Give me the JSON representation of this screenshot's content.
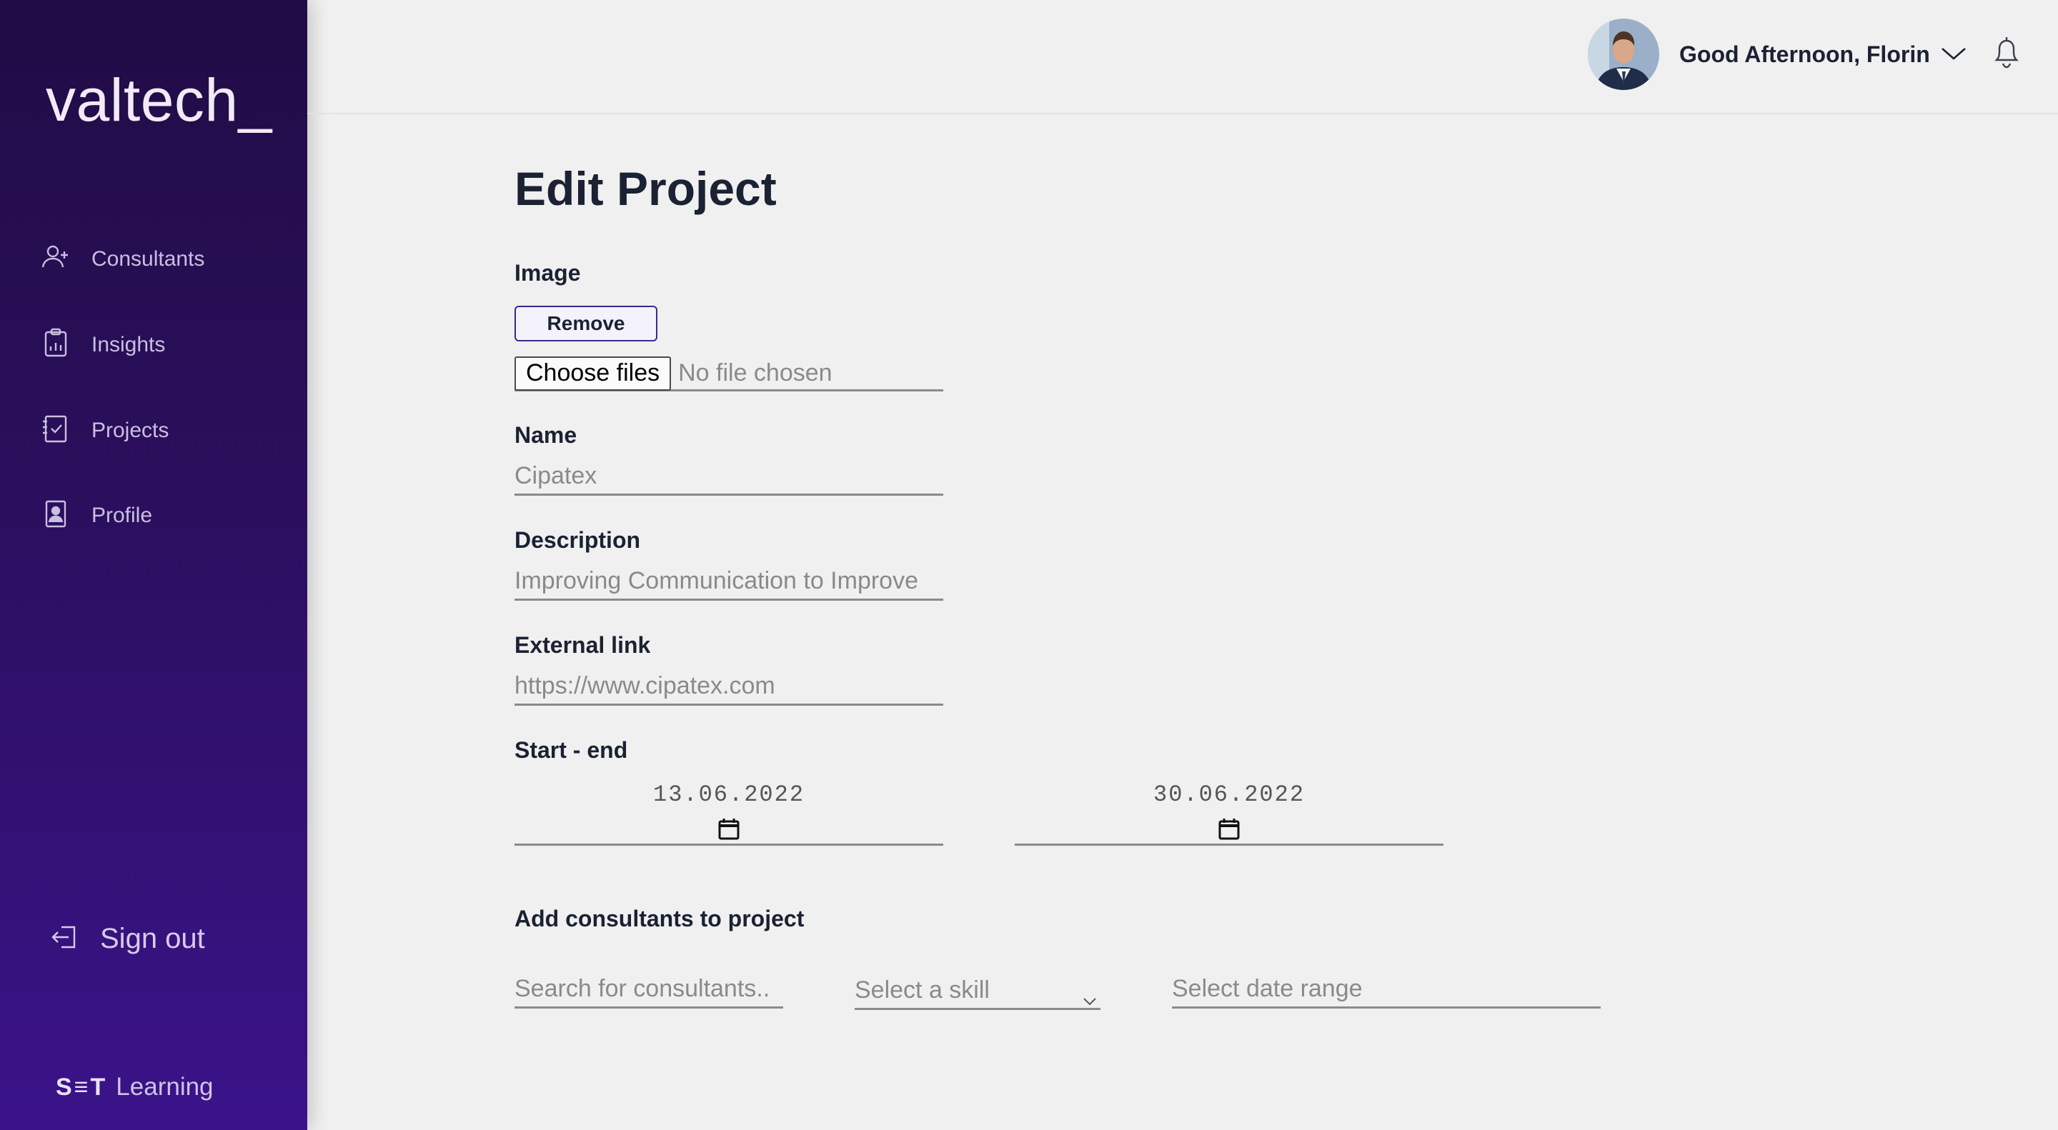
{
  "sidebar": {
    "logo": "valtech_",
    "items": [
      {
        "label": "Consultants",
        "icon": "user-plus-icon"
      },
      {
        "label": "Insights",
        "icon": "clipboard-chart-icon"
      },
      {
        "label": "Projects",
        "icon": "clipboard-check-icon"
      },
      {
        "label": "Profile",
        "icon": "profile-card-icon"
      }
    ],
    "signout_label": "Sign out",
    "brand_mark": "S≡T",
    "brand_text": "Learning"
  },
  "header": {
    "greeting": "Good Afternoon, Florin"
  },
  "form": {
    "title": "Edit Project",
    "image_label": "Image",
    "remove_button": "Remove",
    "choose_files_button": "Choose files",
    "no_file_text": "No file chosen",
    "name_label": "Name",
    "name_value": "Cipatex",
    "description_label": "Description",
    "description_value": "Improving Communication to Improve",
    "external_link_label": "External link",
    "external_link_value": "https://www.cipatex.com",
    "dates_label": "Start - end",
    "start_date": "13.06.2022",
    "end_date": "30.06.2022",
    "consultants_label": "Add consultants to project",
    "search_placeholder": "Search for consultants..",
    "skill_placeholder": "Select a skill",
    "date_range_placeholder": "Select date range"
  }
}
